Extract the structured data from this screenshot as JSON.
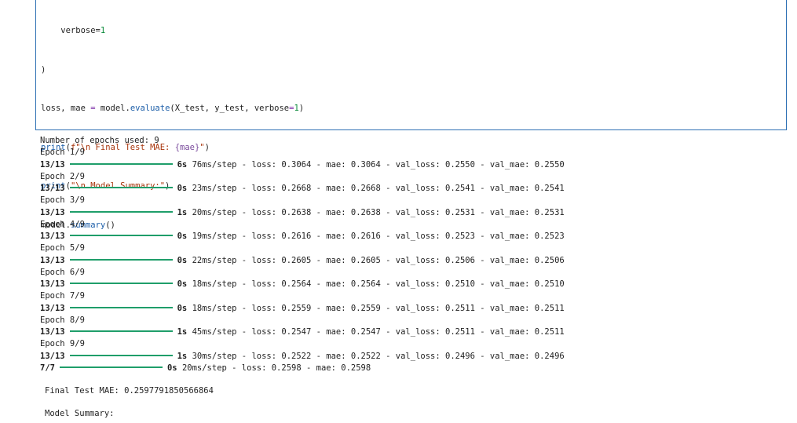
{
  "code": {
    "line1_text": "    verbose=",
    "line1_num": "1",
    "line2": ")",
    "line3_a": "loss, mae ",
    "line3_eq": "=",
    "line3_b": " model.",
    "line3_fn": "evaluate",
    "line3_c": "(X_test, y_test, verbose",
    "line3_eq2": "=",
    "line3_num": "1",
    "line3_d": ")",
    "line4_fn": "print",
    "line4_a": "(",
    "line4_str": "f\"\\n Final Test MAE: ",
    "line4_brace": "{mae}",
    "line4_str2": "\"",
    "line4_b": ")",
    "line5_fn": "print",
    "line5_a": "(",
    "line5_str": "\"\\n Model Summary:\"",
    "line5_b": ")",
    "line6_a": "model.",
    "line6_fn": "summary",
    "line6_b": "()"
  },
  "output": {
    "epochs_used": "Number of epochs used: 9",
    "epochs": [
      {
        "label": "Epoch 1/9",
        "steps": "13/13",
        "time": "6s",
        "rest": "76ms/step - loss: 0.3064 - mae: 0.3064 - val_loss: 0.2550 - val_mae: 0.2550"
      },
      {
        "label": "Epoch 2/9",
        "steps": "13/13",
        "time": "0s",
        "rest": "23ms/step - loss: 0.2668 - mae: 0.2668 - val_loss: 0.2541 - val_mae: 0.2541"
      },
      {
        "label": "Epoch 3/9",
        "steps": "13/13",
        "time": "1s",
        "rest": "20ms/step - loss: 0.2638 - mae: 0.2638 - val_loss: 0.2531 - val_mae: 0.2531"
      },
      {
        "label": "Epoch 4/9",
        "steps": "13/13",
        "time": "0s",
        "rest": "19ms/step - loss: 0.2616 - mae: 0.2616 - val_loss: 0.2523 - val_mae: 0.2523"
      },
      {
        "label": "Epoch 5/9",
        "steps": "13/13",
        "time": "0s",
        "rest": "22ms/step - loss: 0.2605 - mae: 0.2605 - val_loss: 0.2506 - val_mae: 0.2506"
      },
      {
        "label": "Epoch 6/9",
        "steps": "13/13",
        "time": "0s",
        "rest": "18ms/step - loss: 0.2564 - mae: 0.2564 - val_loss: 0.2510 - val_mae: 0.2510"
      },
      {
        "label": "Epoch 7/9",
        "steps": "13/13",
        "time": "0s",
        "rest": "18ms/step - loss: 0.2559 - mae: 0.2559 - val_loss: 0.2511 - val_mae: 0.2511"
      },
      {
        "label": "Epoch 8/9",
        "steps": "13/13",
        "time": "1s",
        "rest": "45ms/step - loss: 0.2547 - mae: 0.2547 - val_loss: 0.2511 - val_mae: 0.2511"
      },
      {
        "label": "Epoch 9/9",
        "steps": "13/13",
        "time": "1s",
        "rest": "30ms/step - loss: 0.2522 - mae: 0.2522 - val_loss: 0.2496 - val_mae: 0.2496"
      }
    ],
    "eval": {
      "steps": "7/7",
      "time": "0s",
      "rest": "20ms/step - loss: 0.2598 - mae: 0.2598"
    },
    "final_mae": "Final Test MAE: 0.2597791850566864",
    "model_summary": "Model Summary:"
  },
  "colors": {
    "progress_bar": "#1f9e6a",
    "cell_border": "#2c6fb3"
  }
}
